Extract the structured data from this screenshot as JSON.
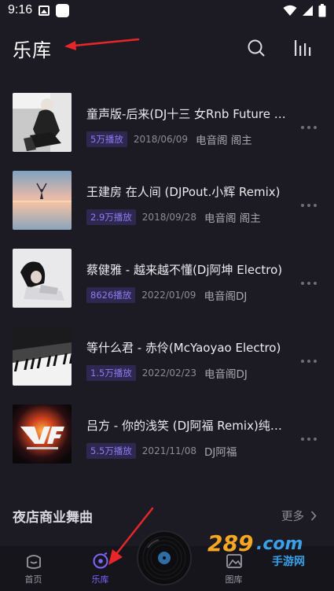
{
  "status_bar": {
    "time": "9:16"
  },
  "header": {
    "title": "乐库"
  },
  "songs": [
    {
      "title": "童声版-后来(DJ十三 女Rnb Future Bass)",
      "plays": "5万播放",
      "date": "2018/06/09",
      "uploader": "电音阁 阁主"
    },
    {
      "title": "王建房 在人间 (DJPout.小辉 Remix)",
      "plays": "2.9万播放",
      "date": "2018/09/28",
      "uploader": "电音阁 阁主"
    },
    {
      "title": "蔡健雅 - 越来越不懂(Dj阿坤 Electro)",
      "plays": "8626播放",
      "date": "2022/01/09",
      "uploader": "电音阁DJ"
    },
    {
      "title": "等什么君 - 赤伶(McYaoyao Electro)",
      "plays": "1.5万播放",
      "date": "2022/02/23",
      "uploader": "电音阁DJ"
    },
    {
      "title": "吕方 - 你的浅笑 (DJ阿福 Remix)纯音乐",
      "plays": "5.5万播放",
      "date": "2021/11/08",
      "uploader": "DJ阿福"
    }
  ],
  "section": {
    "title": "夜店商业舞曲",
    "more_label": "更多"
  },
  "bottom_nav": {
    "items": [
      {
        "label": "首页",
        "icon": "home-icon"
      },
      {
        "label": "乐库",
        "icon": "music-library-icon",
        "active": true
      },
      {
        "label": "",
        "icon": "vinyl-disc-icon"
      },
      {
        "label": "图库",
        "icon": "gallery-icon"
      },
      {
        "label": "",
        "icon": ""
      }
    ]
  },
  "watermark": {
    "text": "289.com",
    "subtext": "手游网"
  },
  "colors": {
    "background": "#1c1b23",
    "accent": "#7b66ff",
    "badge_bg": "#2e2850",
    "badge_text": "#8c7cf0",
    "arrow": "#e8262a"
  }
}
